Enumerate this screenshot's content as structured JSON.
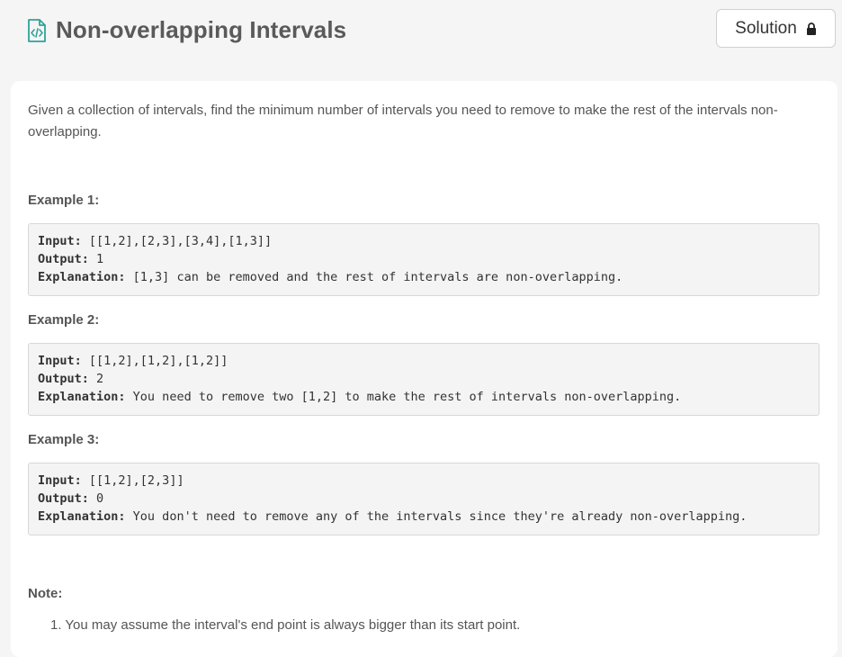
{
  "header": {
    "title": "Non-overlapping Intervals",
    "solution_label": "Solution"
  },
  "problem": {
    "description": "Given a collection of intervals, find the minimum number of intervals you need to remove to make the rest of the intervals non-overlapping."
  },
  "examples": [
    {
      "title": "Example 1:",
      "input_label": "Input:",
      "input": " [[1,2],[2,3],[3,4],[1,3]]",
      "output_label": "Output:",
      "output": " 1",
      "explanation_label": "Explanation:",
      "explanation": " [1,3] can be removed and the rest of intervals are non-overlapping."
    },
    {
      "title": "Example 2:",
      "input_label": "Input:",
      "input": " [[1,2],[1,2],[1,2]]",
      "output_label": "Output:",
      "output": " 2",
      "explanation_label": "Explanation:",
      "explanation": " You need to remove two [1,2] to make the rest of intervals non-overlapping."
    },
    {
      "title": "Example 3:",
      "input_label": "Input:",
      "input": " [[1,2],[2,3]]",
      "output_label": "Output:",
      "output": " 0",
      "explanation_label": "Explanation:",
      "explanation": " You don't need to remove any of the intervals since they're already non-overlapping."
    }
  ],
  "note": {
    "title": "Note:",
    "items": [
      "1. You may assume the interval's end point is always bigger than its start point."
    ]
  },
  "colors": {
    "icon_accent": "#2ea39a",
    "page_bg": "#f5f5f5"
  }
}
